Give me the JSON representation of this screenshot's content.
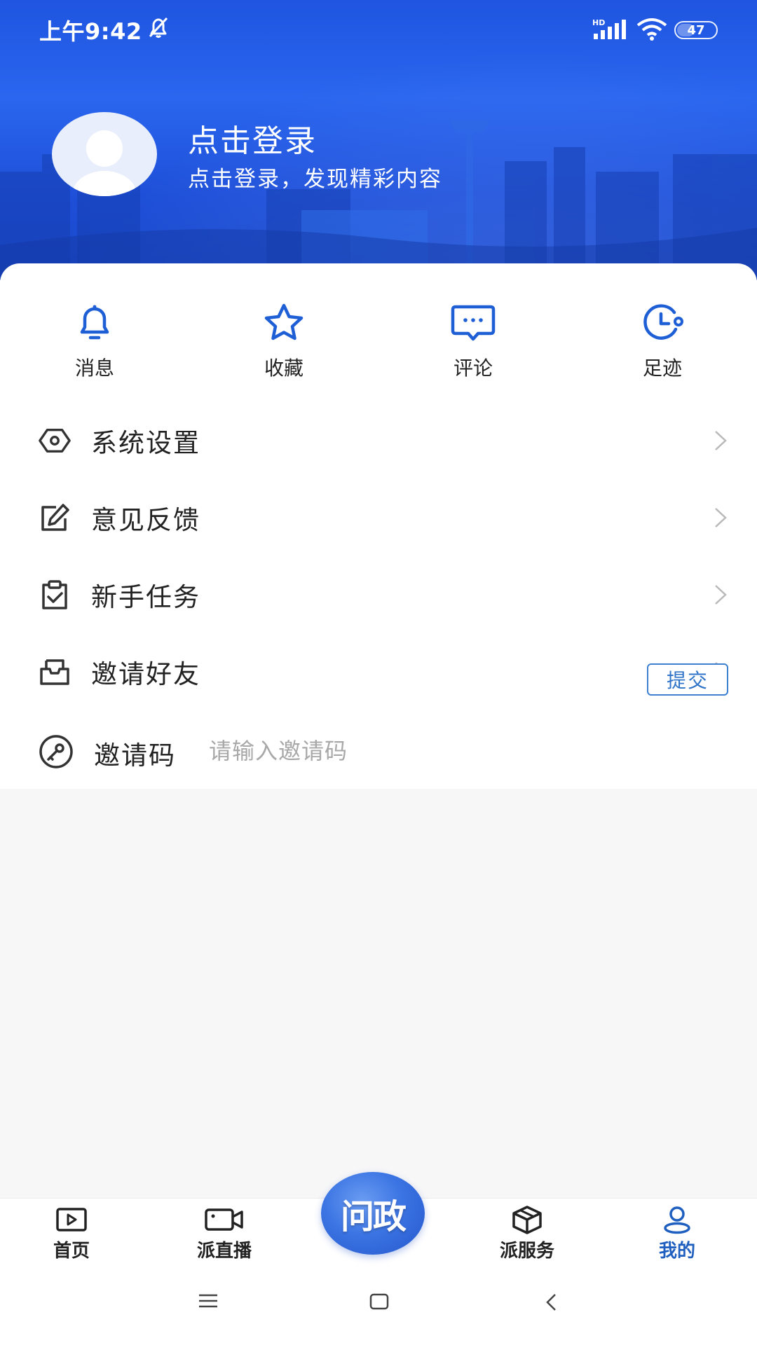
{
  "status_bar": {
    "time": "上午9:42",
    "network": "HD",
    "battery": "47",
    "battery_level": 0.47
  },
  "profile": {
    "title": "点击登录",
    "subtitle": "点击登录，发现精彩内容"
  },
  "quick_actions": [
    {
      "label": "消息",
      "icon": "bell-icon"
    },
    {
      "label": "收藏",
      "icon": "star-icon"
    },
    {
      "label": "评论",
      "icon": "comment-icon"
    },
    {
      "label": "足迹",
      "icon": "clock-icon"
    }
  ],
  "menu": [
    {
      "label": "系统设置",
      "icon": "settings-icon"
    },
    {
      "label": "意见反馈",
      "icon": "edit-icon"
    },
    {
      "label": "新手任务",
      "icon": "clipboard-check-icon"
    },
    {
      "label": "邀请好友",
      "icon": "inbox-icon"
    }
  ],
  "invite": {
    "label": "邀请码",
    "placeholder": "请输入邀请码",
    "value": "",
    "submit_label": "提交"
  },
  "tabbar": {
    "items": [
      {
        "label": "首页",
        "icon": "play-square-icon",
        "active": false
      },
      {
        "label": "派直播",
        "icon": "video-camera-icon",
        "active": false
      },
      {
        "label": "派服务",
        "icon": "box-icon",
        "active": false
      },
      {
        "label": "我的",
        "icon": "user-icon",
        "active": true
      }
    ],
    "center_label": "问政"
  },
  "colors": {
    "header_blue": "#1f55e0",
    "icon_blue": "#1f5fd6",
    "active_tab": "#1f5fbf",
    "submit_border": "#3d7fd0"
  }
}
